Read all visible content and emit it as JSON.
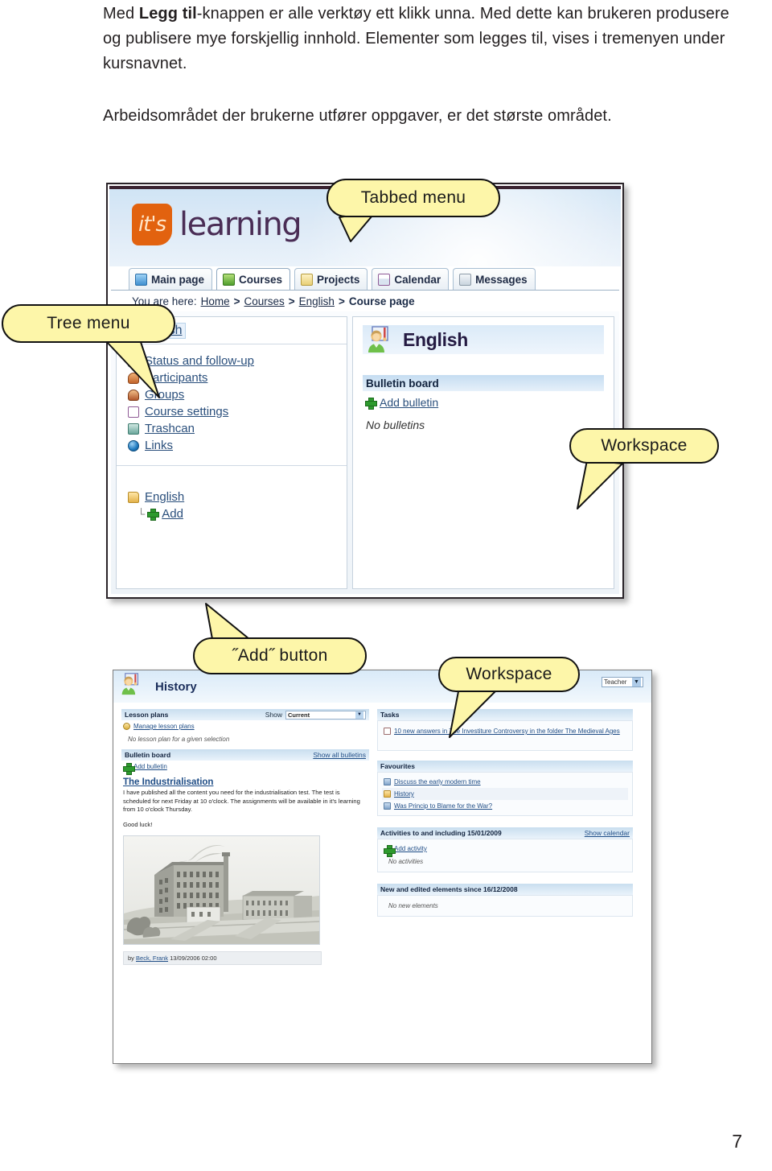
{
  "intro": {
    "para1_pre": "Med ",
    "para1_bold": "Legg til",
    "para1_post": "-knappen er alle verktøy ett klikk unna. Med dette kan brukeren produsere og publisere mye forskjellig innhold. Elementer som legges til, vises i tremenyen under kursnavnet.",
    "para2": "Arbeidsområdet der brukerne utfører oppgaver, er det største området."
  },
  "page_number": "7",
  "callouts": [
    {
      "id": "tabbed-menu",
      "label": "Tabbed menu"
    },
    {
      "id": "tree-menu",
      "label": "Tree menu"
    },
    {
      "id": "workspace-1",
      "label": "Workspace"
    },
    {
      "id": "add-button",
      "label": "˝Add˝ button"
    },
    {
      "id": "workspace-2",
      "label": "Workspace"
    }
  ],
  "shot1": {
    "logo": {
      "mark": "it's",
      "word": "learning"
    },
    "tabs": [
      {
        "label": "Main page",
        "icon": "home-icon",
        "active": false
      },
      {
        "label": "Courses",
        "icon": "courses-icon",
        "active": true
      },
      {
        "label": "Projects",
        "icon": "clipboard-icon",
        "active": false
      },
      {
        "label": "Calendar",
        "icon": "calendar-icon",
        "active": false
      },
      {
        "label": "Messages",
        "icon": "envelope-icon",
        "active": false
      }
    ],
    "breadcrumb": {
      "prefix": "You are here:",
      "items": [
        "Home",
        "Courses",
        "English",
        "Course page"
      ],
      "separator": ">"
    },
    "tree": {
      "course": "English",
      "items": [
        {
          "label": "Status and follow-up",
          "icon": "status-icon"
        },
        {
          "label": "Participants",
          "icon": "person-icon"
        },
        {
          "label": "Groups",
          "icon": "groups-icon"
        },
        {
          "label": "Course settings",
          "icon": "settings-icon"
        },
        {
          "label": "Trashcan",
          "icon": "trashcan-icon"
        },
        {
          "label": "Links",
          "icon": "globe-icon"
        }
      ],
      "folder": {
        "label": "English",
        "icon": "folder-icon"
      },
      "add": {
        "label": "Add",
        "icon": "plus-icon"
      }
    },
    "workspace": {
      "title": "English",
      "avatar": "teacher-avatar-icon",
      "bulletin": {
        "heading": "Bulletin board",
        "add_label": "Add bulletin",
        "empty": "No bulletins"
      }
    }
  },
  "shot2": {
    "title": "History",
    "avatar": "teacher-avatar-icon",
    "role_select": {
      "value": "Teacher"
    },
    "left": {
      "lesson_plans": {
        "heading": "Lesson plans",
        "show_label": "Show",
        "show_value": "Current",
        "manage_link": "Manage lesson plans",
        "empty": "No lesson plan for a given selection"
      },
      "bulletin_board": {
        "heading": "Bulletin board",
        "show_all": "Show all bulletins",
        "add_label": "Add bulletin",
        "post_title": "The Industrialisation",
        "post_body": "I have published all the content you need for the industrialisation test. The test is scheduled for next Friday at 10 o'clock. The assignments will be available in it's learning from 10 o'clock Thursday.",
        "post_body2": "Good luck!",
        "image_alt": "industrial-mill-engraving",
        "byline_prefix": "by ",
        "byline_author": "Beck, Frank",
        "byline_date": "13/09/2006 02:00"
      }
    },
    "right": {
      "tasks": {
        "heading": "Tasks",
        "items": [
          {
            "label": "10 new answers in The Investiture Controversy in the folder The Medieval Ages",
            "icon": "document-icon"
          }
        ]
      },
      "favourites": {
        "heading": "Favourites",
        "items": [
          {
            "label": "Discuss the early modern time",
            "icon": "discussion-icon"
          },
          {
            "label": "History",
            "icon": "folder-icon"
          },
          {
            "label": "Was Princip to Blame for the War?",
            "icon": "discussion-icon"
          }
        ]
      },
      "activities": {
        "heading": "Activities to and including 15/01/2009",
        "show_calendar": "Show calendar",
        "add_label": "Add activity",
        "empty": "No activities"
      },
      "new_elements": {
        "heading": "New and edited elements since 16/12/2008",
        "empty": "No new elements"
      }
    }
  },
  "colors": {
    "callout_fill": "#fdf6a9",
    "brand_orange": "#e2620f",
    "brand_purple": "#4a2d55",
    "link_blue": "#2a4f7c",
    "header_blue": "#c5dcf1"
  }
}
